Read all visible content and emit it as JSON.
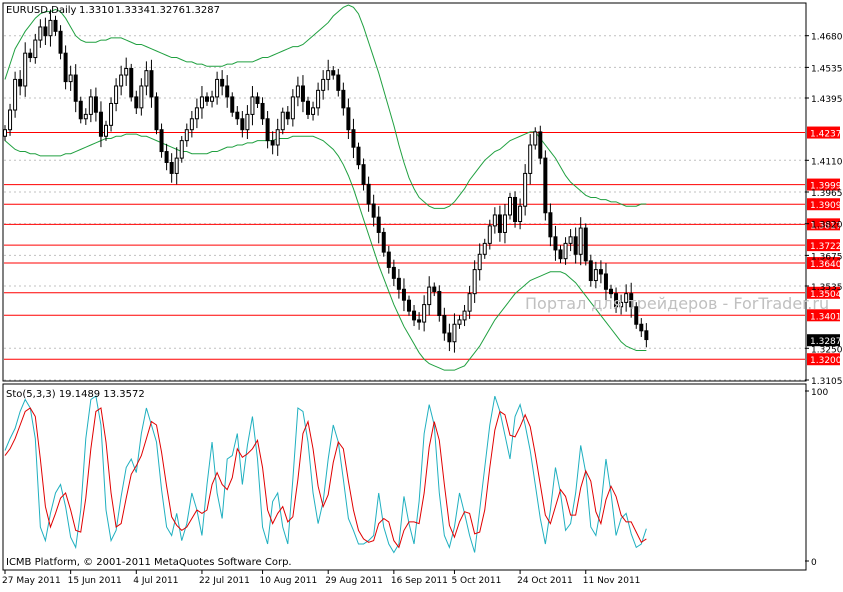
{
  "chart_data": [
    {
      "type": "candlestick",
      "title": "EURUSD,Daily",
      "ohlc_label": [
        "1.3310",
        "1.3334",
        "1.3276",
        "1.3287"
      ],
      "last_price_label": "1.3287",
      "watermark": "Портал для трейдеров - ForTrader.ru",
      "ylim": [
        1.3105,
        1.4825
      ],
      "y_ticks": [
        "1.4680",
        "1.4535",
        "1.4395",
        "1.4110",
        "1.3965",
        "1.3820",
        "1.3675",
        "1.3535",
        "1.3250",
        "1.3105"
      ],
      "levels": [
        1.4237,
        1.3999,
        1.3909,
        1.3817,
        1.3722,
        1.364,
        1.3504,
        1.3401,
        1.32
      ],
      "level_labels": [
        "1.4237",
        "1.3999",
        "1.3909",
        "1.3817",
        "1.3722",
        "1.3640",
        "1.3504",
        "1.3401",
        "1.3200"
      ],
      "colors": {
        "level": "#ff0000",
        "level_bg": "#ff0000",
        "band": "#20a040",
        "candle": "#000000",
        "grid": "#c0c0c0",
        "axis": "#000000"
      },
      "closes": [
        1.425,
        1.434,
        1.448,
        1.445,
        1.46,
        1.458,
        1.466,
        1.472,
        1.468,
        1.475,
        1.47,
        1.46,
        1.447,
        1.45,
        1.438,
        1.43,
        1.432,
        1.44,
        1.433,
        1.422,
        1.427,
        1.437,
        1.445,
        1.45,
        1.453,
        1.44,
        1.435,
        1.445,
        1.452,
        1.44,
        1.425,
        1.415,
        1.41,
        1.405,
        1.412,
        1.42,
        1.425,
        1.43,
        1.435,
        1.44,
        1.438,
        1.44,
        1.448,
        1.445,
        1.44,
        1.433,
        1.43,
        1.425,
        1.432,
        1.44,
        1.437,
        1.43,
        1.42,
        1.418,
        1.425,
        1.433,
        1.43,
        1.44,
        1.445,
        1.438,
        1.432,
        1.435,
        1.443,
        1.448,
        1.452,
        1.45,
        1.443,
        1.435,
        1.425,
        1.417,
        1.409,
        1.4,
        1.391,
        1.385,
        1.378,
        1.369,
        1.362,
        1.357,
        1.352,
        1.347,
        1.342,
        1.338,
        1.337,
        1.345,
        1.353,
        1.351,
        1.34,
        1.332,
        1.328,
        1.336,
        1.338,
        1.342,
        1.35,
        1.361,
        1.368,
        1.373,
        1.381,
        1.386,
        1.378,
        1.386,
        1.394,
        1.383,
        1.39,
        1.405,
        1.418,
        1.424,
        1.412,
        1.387,
        1.376,
        1.37,
        1.366,
        1.373,
        1.376,
        1.368,
        1.38,
        1.365,
        1.356,
        1.361,
        1.359,
        1.352,
        1.35,
        1.344,
        1.346,
        1.35,
        1.344,
        1.336,
        1.333,
        1.329
      ],
      "upper_band": [
        1.448,
        1.455,
        1.462,
        1.466,
        1.47,
        1.473,
        1.476,
        1.478,
        1.479,
        1.479,
        1.48,
        1.479,
        1.476,
        1.472,
        1.468,
        1.466,
        1.465,
        1.465,
        1.465,
        1.466,
        1.466,
        1.467,
        1.467,
        1.467,
        1.466,
        1.465,
        1.464,
        1.464,
        1.463,
        1.462,
        1.461,
        1.46,
        1.459,
        1.458,
        1.458,
        1.457,
        1.456,
        1.456,
        1.455,
        1.455,
        1.454,
        1.454,
        1.454,
        1.454,
        1.455,
        1.455,
        1.456,
        1.456,
        1.456,
        1.456,
        1.457,
        1.458,
        1.458,
        1.459,
        1.46,
        1.461,
        1.462,
        1.463,
        1.463,
        1.464,
        1.466,
        1.468,
        1.47,
        1.472,
        1.474,
        1.477,
        1.479,
        1.481,
        1.482,
        1.481,
        1.478,
        1.472,
        1.465,
        1.458,
        1.451,
        1.443,
        1.435,
        1.427,
        1.418,
        1.41,
        1.403,
        1.398,
        1.394,
        1.392,
        1.39,
        1.389,
        1.389,
        1.389,
        1.39,
        1.392,
        1.395,
        1.398,
        1.402,
        1.405,
        1.408,
        1.411,
        1.413,
        1.415,
        1.416,
        1.418,
        1.42,
        1.421,
        1.422,
        1.423,
        1.424,
        1.424,
        1.421,
        1.418,
        1.415,
        1.412,
        1.408,
        1.404,
        1.401,
        1.399,
        1.397,
        1.395,
        1.394,
        1.394,
        1.393,
        1.393,
        1.392,
        1.392,
        1.391,
        1.39,
        1.39,
        1.39,
        1.391,
        1.391
      ],
      "lower_band": [
        1.42,
        1.418,
        1.416,
        1.415,
        1.415,
        1.414,
        1.414,
        1.413,
        1.413,
        1.413,
        1.413,
        1.413,
        1.414,
        1.414,
        1.415,
        1.416,
        1.417,
        1.418,
        1.419,
        1.42,
        1.421,
        1.421,
        1.422,
        1.422,
        1.423,
        1.423,
        1.423,
        1.422,
        1.422,
        1.421,
        1.42,
        1.419,
        1.418,
        1.417,
        1.416,
        1.415,
        1.415,
        1.414,
        1.414,
        1.414,
        1.414,
        1.415,
        1.415,
        1.416,
        1.417,
        1.417,
        1.418,
        1.418,
        1.419,
        1.419,
        1.42,
        1.42,
        1.42,
        1.42,
        1.421,
        1.421,
        1.421,
        1.422,
        1.422,
        1.422,
        1.422,
        1.422,
        1.421,
        1.42,
        1.418,
        1.416,
        1.413,
        1.409,
        1.404,
        1.398,
        1.391,
        1.384,
        1.377,
        1.37,
        1.363,
        1.357,
        1.351,
        1.345,
        1.34,
        1.335,
        1.331,
        1.327,
        1.323,
        1.32,
        1.318,
        1.317,
        1.316,
        1.315,
        1.315,
        1.315,
        1.316,
        1.317,
        1.32,
        1.323,
        1.326,
        1.33,
        1.334,
        1.338,
        1.341,
        1.344,
        1.347,
        1.35,
        1.352,
        1.354,
        1.356,
        1.357,
        1.358,
        1.359,
        1.36,
        1.36,
        1.36,
        1.359,
        1.357,
        1.355,
        1.352,
        1.349,
        1.346,
        1.343,
        1.34,
        1.337,
        1.334,
        1.331,
        1.328,
        1.326,
        1.325,
        1.324,
        1.324,
        1.324
      ]
    },
    {
      "type": "line",
      "title": "Sto(5,3,3) 19.1489 13.3572",
      "ylim": [
        0,
        100
      ],
      "y_ticks": [
        "100",
        "0"
      ],
      "x_tick_labels": [
        "27 May 2011",
        "15 Jun 2011",
        "4 Jul 2011",
        "22 Jul 2011",
        "10 Aug 2011",
        "29 Aug 2011",
        "16 Sep 2011",
        "5 Oct 2011",
        "24 Oct 2011",
        "11 Nov 2011"
      ],
      "series": [
        {
          "name": "",
          "color": "#20b0c0",
          "values": [
            65,
            72,
            78,
            88,
            95,
            90,
            72,
            20,
            12,
            28,
            40,
            45,
            32,
            14,
            8,
            30,
            72,
            95,
            97,
            80,
            30,
            12,
            18,
            38,
            55,
            60,
            52,
            75,
            90,
            80,
            70,
            42,
            20,
            15,
            28,
            12,
            22,
            40,
            30,
            15,
            45,
            70,
            40,
            25,
            60,
            62,
            75,
            45,
            68,
            85,
            60,
            20,
            10,
            35,
            40,
            20,
            10,
            48,
            90,
            88,
            70,
            40,
            22,
            35,
            60,
            80,
            70,
            48,
            25,
            18,
            10,
            10,
            12,
            15,
            40,
            20,
            10,
            5,
            10,
            38,
            22,
            10,
            35,
            75,
            92,
            80,
            40,
            15,
            8,
            20,
            40,
            28,
            15,
            5,
            30,
            55,
            80,
            97,
            88,
            74,
            60,
            85,
            92,
            80,
            65,
            45,
            25,
            10,
            30,
            55,
            40,
            18,
            22,
            40,
            68,
            52,
            20,
            15,
            32,
            60,
            40,
            15,
            25,
            28,
            16,
            8,
            10,
            19
          ]
        },
        {
          "name": "",
          "color": "#e00000",
          "values": [
            62,
            66,
            72,
            80,
            88,
            90,
            85,
            60,
            32,
            20,
            28,
            37,
            40,
            30,
            18,
            17,
            37,
            66,
            88,
            90,
            70,
            40,
            20,
            22,
            37,
            51,
            56,
            62,
            72,
            82,
            80,
            64,
            44,
            26,
            21,
            18,
            20,
            25,
            30,
            28,
            30,
            45,
            52,
            45,
            42,
            49,
            66,
            61,
            63,
            66,
            71,
            55,
            30,
            22,
            28,
            32,
            23,
            26,
            48,
            75,
            82,
            66,
            44,
            32,
            39,
            58,
            70,
            66,
            47,
            30,
            18,
            13,
            11,
            12,
            22,
            25,
            23,
            12,
            8,
            18,
            23,
            23,
            22,
            40,
            67,
            82,
            71,
            45,
            21,
            14,
            23,
            29,
            28,
            16,
            17,
            30,
            55,
            77,
            88,
            86,
            74,
            73,
            79,
            86,
            79,
            63,
            45,
            27,
            22,
            32,
            42,
            38,
            27,
            27,
            43,
            53,
            47,
            29,
            22,
            36,
            44,
            38,
            27,
            23,
            23,
            17,
            11,
            13
          ]
        }
      ]
    }
  ],
  "footer": {
    "copyright": "ICMB Platform, © 2001-2011 MetaQuotes Software Corp."
  }
}
